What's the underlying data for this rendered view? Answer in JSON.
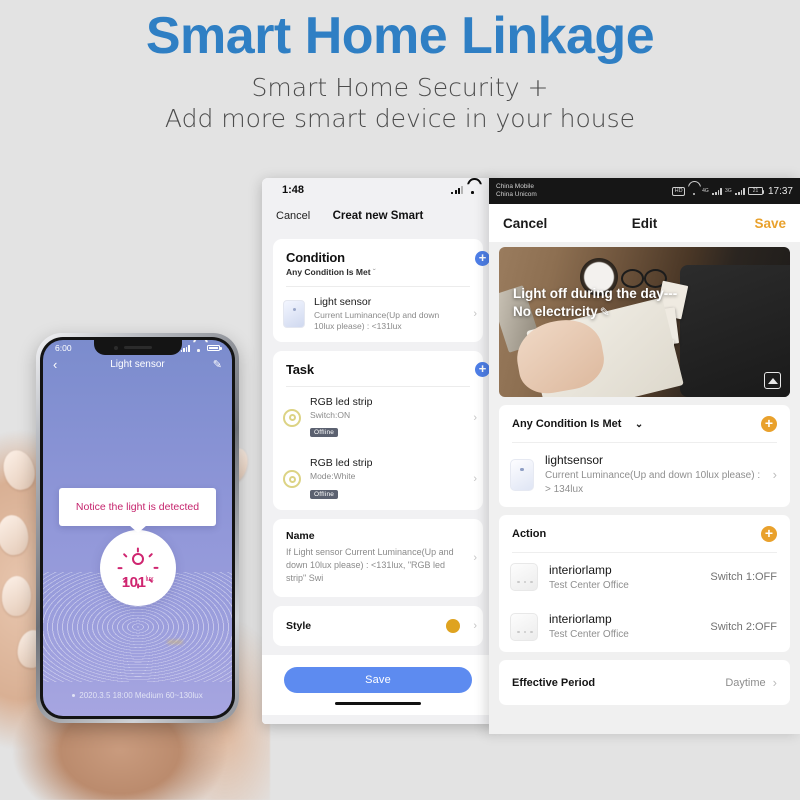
{
  "header": {
    "title": "Smart Home Linkage",
    "subtitle_line1": "Smart Home Security +",
    "subtitle_line2": "Add more smart device in your house",
    "title_color": "#2f7fc4"
  },
  "left_phone": {
    "status": {
      "time": "6:00"
    },
    "nav": {
      "back_icon": "chevron-left",
      "title": "Light sensor",
      "edit_icon": "pencil"
    },
    "toast": "Notice the light is detected",
    "reading": {
      "value": "101",
      "unit": "lux",
      "accent_color": "#cf2570"
    },
    "footer": "2020.3.5 18:00 Medium 60~130lux"
  },
  "mid_phone": {
    "status": {
      "time": "1:48"
    },
    "nav": {
      "cancel": "Cancel",
      "title": "Creat new Smart"
    },
    "condition": {
      "heading": "Condition",
      "subheading": "Any Condition Is Met",
      "caret": "ˇ",
      "add_label": "+",
      "items": [
        {
          "name": "Light sensor",
          "desc": "Current Luminance(Up and down 10lux please) : <131lux"
        }
      ]
    },
    "task": {
      "heading": "Task",
      "add_label": "+",
      "items": [
        {
          "name": "RGB led strip",
          "desc": "Switch:ON",
          "badge": "Offline"
        },
        {
          "name": "RGB led strip",
          "desc": "Mode:White",
          "badge": "Offline"
        }
      ]
    },
    "name_card": {
      "heading": "Name",
      "value": "If Light sensor Current Luminance(Up and down 10lux please) : <131lux, \"RGB led strip\" Swi"
    },
    "style_card": {
      "heading": "Style",
      "swatch_color": "#dfa320"
    },
    "save_label": "Save",
    "accent_color": "#5d8bf0"
  },
  "right_phone": {
    "status": {
      "carrier_line1": "China Mobile",
      "carrier_line2": "China Unicom",
      "hd": "HD",
      "net1": "4G",
      "net2": "3G",
      "battery": "21",
      "time": "17:37"
    },
    "nav": {
      "cancel": "Cancel",
      "title": "Edit",
      "save": "Save",
      "save_color": "#e9a12c"
    },
    "hero": {
      "caption_line1": "Light off during the day---",
      "caption_line2": "No electricity",
      "edit_icon": "pencil",
      "image_icon": "image-placeholder"
    },
    "condition": {
      "heading": "Any Condition Is Met",
      "caret": "⌄",
      "add_label": "+",
      "items": [
        {
          "name": "lightsensor",
          "desc": "Current Luminance(Up and down 10lux please) : > 134lux"
        }
      ]
    },
    "action": {
      "heading": "Action",
      "add_label": "+",
      "items": [
        {
          "name": "interiorlamp",
          "desc": "Test Center Office",
          "value": "Switch 1:OFF"
        },
        {
          "name": "interiorlamp",
          "desc": "Test Center Office",
          "value": "Switch 2:OFF"
        }
      ]
    },
    "effective_period": {
      "heading": "Effective Period",
      "value": "Daytime"
    }
  }
}
